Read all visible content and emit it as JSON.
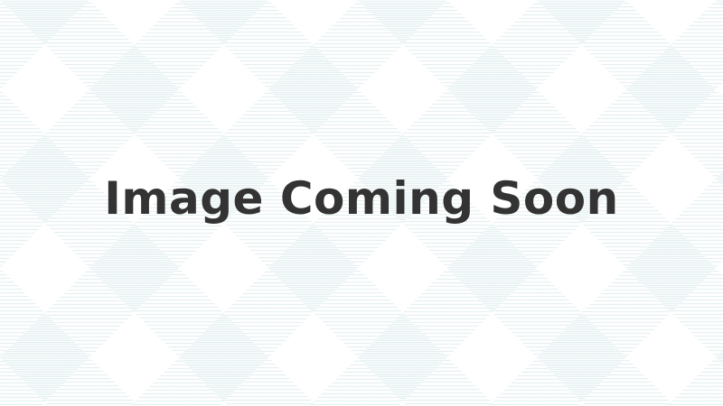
{
  "placeholder": {
    "caption": "Image Coming Soon",
    "background_color": "#ffffff",
    "stripe_color": "#cfe3e6",
    "text_color": "#333333"
  }
}
